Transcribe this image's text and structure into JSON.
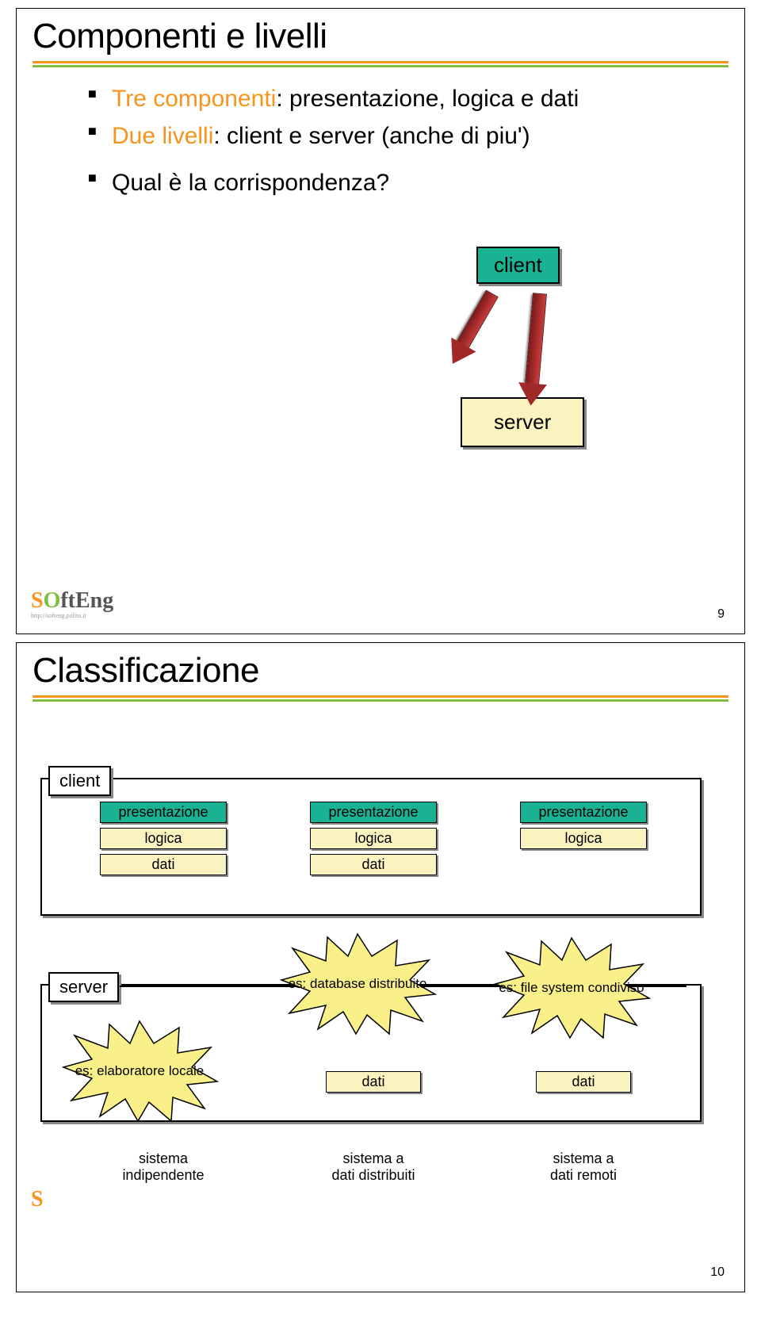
{
  "slide1": {
    "title": "Componenti e livelli",
    "b1_lead": "Tre componenti",
    "b1_rest": ": presentazione, logica e dati",
    "b2_lead": "Due livelli",
    "b2_rest": ": client e server (anche di piu')",
    "b3": "Qual è la corrispondenza?",
    "box_client": "client",
    "box_server": "server",
    "page": "9"
  },
  "slide2": {
    "title": "Classificazione",
    "client_label": "client",
    "server_label": "server",
    "presentazione": "presentazione",
    "logica": "logica",
    "dati": "dati",
    "burst_elab": "es: elaboratore locale",
    "burst_db": "es: database distribuito",
    "burst_fs": "es: file system condiviso",
    "sys_ind": "sistema\nindipendente",
    "sys_dist": "sistema a\ndati distribuiti",
    "sys_rem": "sistema a\ndati remoti",
    "page": "10"
  },
  "logo": {
    "s": "S",
    "o": "O",
    "rest": "ftEng",
    "sub": "http://softeng.polito.it"
  }
}
